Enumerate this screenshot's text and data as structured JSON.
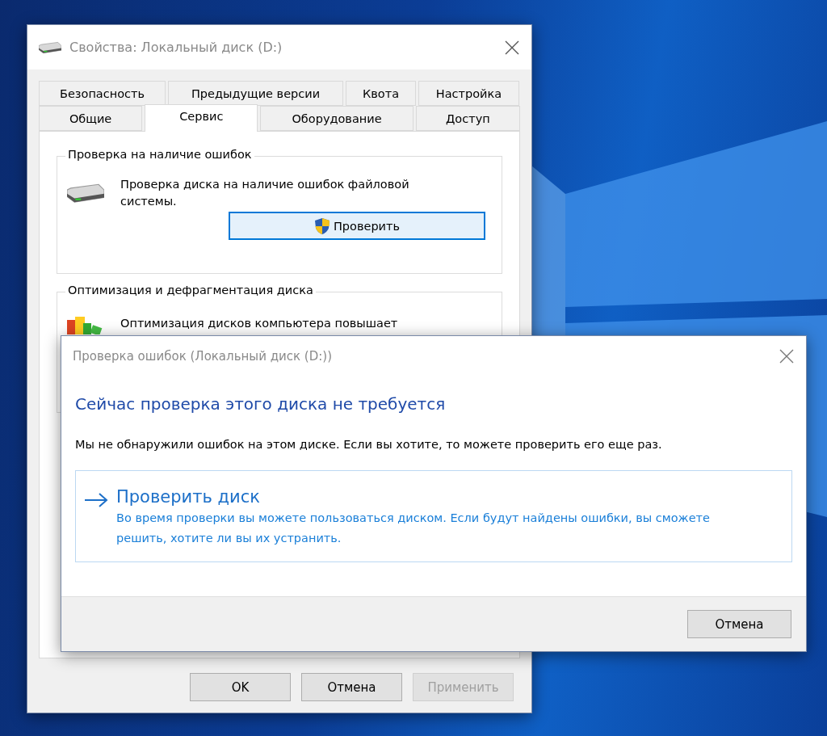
{
  "properties_window": {
    "title": "Свойства: Локальный диск (D:)",
    "tabs_back": [
      {
        "label": "Безопасность",
        "selected": false
      },
      {
        "label": "Предыдущие версии",
        "selected": false
      },
      {
        "label": "Квота",
        "selected": false
      },
      {
        "label": "Настройка",
        "selected": false
      }
    ],
    "tabs_front": [
      {
        "label": "Общие",
        "selected": false
      },
      {
        "label": "Сервис",
        "selected": true
      },
      {
        "label": "Оборудование",
        "selected": false
      },
      {
        "label": "Доступ",
        "selected": false
      }
    ],
    "error_check": {
      "title": "Проверка на наличие ошибок",
      "description": "Проверка диска на наличие ошибок файловой системы.",
      "button": "Проверить"
    },
    "optimization": {
      "title": "Оптимизация и дефрагментация диска",
      "description": "Оптимизация дисков компьютера повышает"
    },
    "buttons": [
      {
        "label": "OK",
        "disabled": false
      },
      {
        "label": "Отмена",
        "disabled": false
      },
      {
        "label": "Применить",
        "disabled": true
      }
    ]
  },
  "check_dialog": {
    "title": "Проверка ошибок (Локальный диск (D:))",
    "heading": "Сейчас проверка этого диска не требуется",
    "message": "Мы не обнаружили ошибок на этом диске. Если вы хотите, то можете проверить его еще раз.",
    "action": {
      "label": "Проверить диск",
      "description": "Во время проверки вы можете пользоваться диском. Если будут найдены ошибки, вы сможете решить, хотите ли вы их устранить."
    },
    "buttons": [
      {
        "label": "Отмена"
      }
    ]
  }
}
